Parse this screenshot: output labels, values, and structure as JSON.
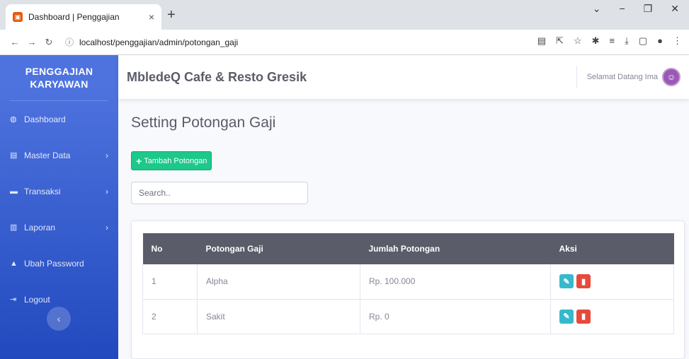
{
  "browser": {
    "tab_title": "Dashboard | Penggajian",
    "tab_close": "×",
    "new_tab": "+",
    "url": "localhost/penggajian/admin/potongan_gaji"
  },
  "sidebar": {
    "brand": "PENGGAJIAN KARYAWAN",
    "items": [
      {
        "label": "Dashboard",
        "icon": "dashboard-icon",
        "has_chevron": false
      },
      {
        "label": "Master Data",
        "icon": "database-icon",
        "has_chevron": true
      },
      {
        "label": "Transaksi",
        "icon": "money-icon",
        "has_chevron": true
      },
      {
        "label": "Laporan",
        "icon": "copy-icon",
        "has_chevron": true
      },
      {
        "label": "Ubah Password",
        "icon": "lock-icon",
        "has_chevron": false
      },
      {
        "label": "Logout",
        "icon": "sign-out-icon",
        "has_chevron": false
      }
    ],
    "colors": {
      "from": "#4e73df",
      "to": "#224abe"
    }
  },
  "topbar": {
    "app_title": "MbledeQ Cafe & Resto Gresik",
    "welcome": "Selamat Datang Ima"
  },
  "main": {
    "page_title": "Setting Potongan Gaji",
    "add_button": "Tambah Potongan",
    "search_placeholder": "Search..",
    "table": {
      "headers": [
        "No",
        "Potongan Gaji",
        "Jumlah Potongan",
        "Aksi"
      ],
      "rows": [
        {
          "no": "1",
          "potongan": "Alpha",
          "jumlah": "Rp. 100.000"
        },
        {
          "no": "2",
          "potongan": "Sakit",
          "jumlah": "Rp. 0"
        }
      ]
    },
    "colors": {
      "success": "#1cc88a",
      "info": "#36b9cc",
      "danger": "#e74a3b",
      "header": "#5a5c69"
    }
  }
}
